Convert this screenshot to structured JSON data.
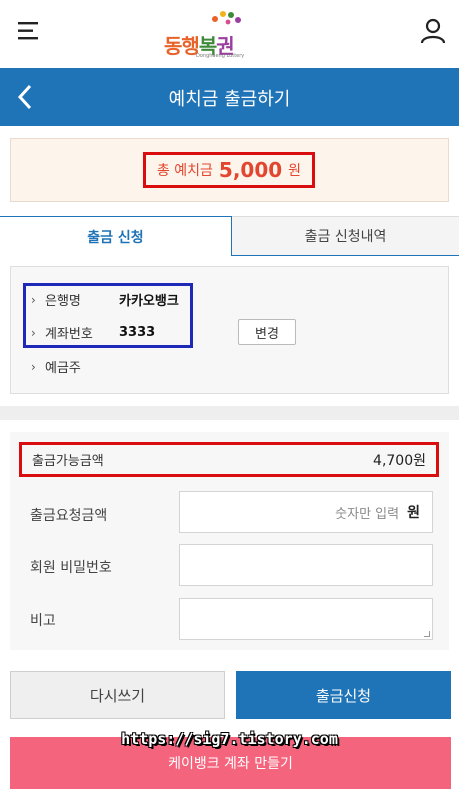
{
  "app": {
    "logo_text_1": "동행",
    "logo_text_2": "복",
    "logo_text_3": "권",
    "logo_sub": "Donghaeng Lottery"
  },
  "header": {
    "title": "예치금 출금하기"
  },
  "balance": {
    "label": "총 예치금",
    "amount": "5,000",
    "unit": "원"
  },
  "tabs": [
    {
      "label": "출금 신청",
      "active": true
    },
    {
      "label": "출금 신청내역",
      "active": false
    }
  ],
  "account": {
    "bank_label": "은행명",
    "bank_value": "카카오뱅크",
    "number_label": "계좌번호",
    "number_value": "3333",
    "holder_label": "예금주",
    "change_button": "변경"
  },
  "form": {
    "available_label": "출금가능금액",
    "available_value": "4,700원",
    "request_label": "출금요청금액",
    "request_placeholder": "숫자만 입력",
    "request_unit": "원",
    "password_label": "회원 비밀번호",
    "memo_label": "비고"
  },
  "buttons": {
    "reset": "다시쓰기",
    "submit": "출금신청",
    "kbank": "케이뱅크 계좌 만들기"
  },
  "watermark": "https://sig7.tistory.com",
  "colors": {
    "primary_blue": "#1f74b8",
    "highlight_red": "#d90d0d",
    "highlight_blue": "#1e29b8",
    "kbank_pink": "#f5647d",
    "balance_orange": "#e3462e"
  }
}
